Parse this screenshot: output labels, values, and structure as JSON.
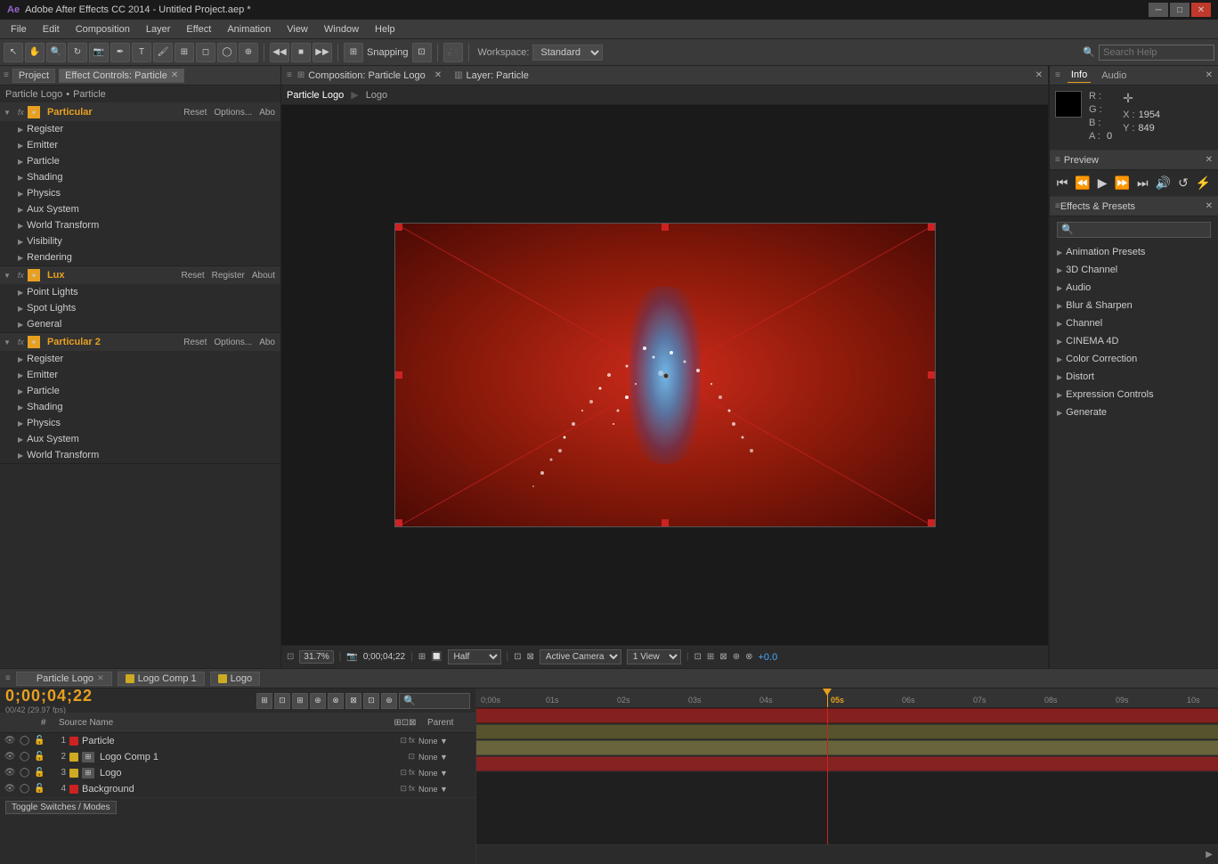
{
  "titlebar": {
    "title": "Adobe After Effects CC 2014 - Untitled Project.aep *",
    "ae_icon": "AE",
    "controls": [
      "minimize",
      "maximize",
      "close"
    ]
  },
  "menubar": {
    "items": [
      "File",
      "Edit",
      "Composition",
      "Layer",
      "Effect",
      "Animation",
      "View",
      "Window",
      "Help"
    ]
  },
  "toolbar": {
    "snapping_label": "Snapping",
    "workspace_label": "Workspace:",
    "workspace_value": "Standard",
    "search_placeholder": "Search Help"
  },
  "left_panel": {
    "title": "Effect Controls: Particle",
    "project_tab": "Project",
    "effect_controls_tab": "Effect Controls: Particle",
    "breadcrumb_item1": "Particle Logo",
    "breadcrumb_sep": "•",
    "breadcrumb_item2": "Particle",
    "particular1": {
      "name": "Particular",
      "badge": "fx",
      "reset": "Reset",
      "options": "Options...",
      "about": "Abo",
      "items": [
        "Register",
        "Emitter",
        "Particle",
        "Shading",
        "Physics",
        "Aux System",
        "World Transform",
        "Visibility",
        "Rendering"
      ]
    },
    "lux": {
      "name": "Lux",
      "badge": "fx",
      "reset": "Reset",
      "register": "Register",
      "about": "About",
      "items": [
        "Point Lights",
        "Spot Lights",
        "General"
      ]
    },
    "particular2": {
      "name": "Particular 2",
      "badge": "fx",
      "reset": "Reset",
      "options": "Options...",
      "about": "Abo",
      "items": [
        "Register",
        "Emitter",
        "Particle",
        "Shading",
        "Physics",
        "Aux System",
        "World Transform"
      ]
    }
  },
  "composition_panel": {
    "title": "Composition: Particle Logo",
    "nav_items": [
      "Particle Logo",
      "Logo"
    ],
    "viewport": {
      "zoom": "31.7%",
      "time": "0;00;04;22",
      "quality": "Half",
      "active_camera": "Active Camera",
      "view": "1 View",
      "plus_value": "+0.0"
    }
  },
  "layer_panel": {
    "title": "Layer: Particle"
  },
  "right_panel": {
    "info_tab": "Info",
    "audio_tab": "Audio",
    "color": {
      "r": "R :",
      "g": "G :",
      "b": "B :",
      "a": "A :",
      "r_val": "",
      "g_val": "",
      "b_val": "",
      "a_val": "0"
    },
    "coords": {
      "x_label": "X :",
      "x_val": "1954",
      "y_label": "Y :",
      "y_val": "849"
    },
    "preview": {
      "title": "Preview",
      "buttons": [
        "⏮",
        "⏭",
        "▶",
        "⏸",
        "⏭",
        "🔊",
        "↺",
        "⚡"
      ]
    },
    "effects_presets": {
      "title": "Effects & Presets",
      "search_placeholder": "🔍",
      "items": [
        "Animation Presets",
        "3D Channel",
        "Audio",
        "Blur & Sharpen",
        "Channel",
        "CINEMA 4D",
        "Color Correction",
        "Distort",
        "Expression Controls",
        "Generate"
      ]
    }
  },
  "timeline": {
    "tabs": [
      "Particle Logo",
      "Logo Comp 1",
      "Logo"
    ],
    "time": "0;00;04;22",
    "fps": "00/42 (29.97 fps)",
    "layers": [
      {
        "num": 1,
        "name": "Particle",
        "color": "#cc2222",
        "has_fx": true
      },
      {
        "num": 2,
        "name": "Logo Comp 1",
        "color": "#ccaa22",
        "has_fx": false
      },
      {
        "num": 3,
        "name": "Logo",
        "color": "#ccaa22",
        "has_fx": true
      },
      {
        "num": 4,
        "name": "Background",
        "color": "#cc2222",
        "has_fx": true
      }
    ],
    "ruler_marks": [
      "0;00s",
      "01s",
      "02s",
      "03s",
      "04s",
      "05s",
      "06s",
      "07s",
      "08s",
      "09s",
      "10s"
    ],
    "playhead_time": "05s",
    "footer": {
      "toggle": "Toggle Switches / Modes"
    }
  }
}
